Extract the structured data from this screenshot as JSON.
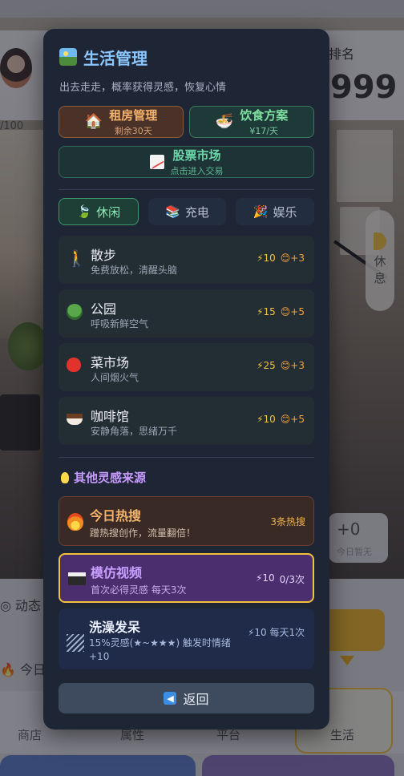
{
  "background": {
    "rank_label": "排名",
    "rank_value": "999",
    "progress_text": "/100",
    "rest_label": "休息",
    "plus_value": "+0",
    "plus_sub": "今日暂无",
    "dynamic_label": "动态",
    "today_label": "今日",
    "tabs": [
      "商店",
      "属性",
      "平台",
      "生活"
    ]
  },
  "modal": {
    "title": "生活管理",
    "subtitle": "出去走走，概率获得灵感，恢复心情",
    "rent": {
      "label": "租房管理",
      "detail": "剩余30天"
    },
    "food": {
      "label": "饮食方案",
      "detail": "¥17/天"
    },
    "stock": {
      "label": "股票市场",
      "detail": "点击进入交易"
    },
    "tabs": [
      {
        "label": "休闲",
        "icon": "leaf-icon"
      },
      {
        "label": "充电",
        "icon": "books-icon"
      },
      {
        "label": "娱乐",
        "icon": "party-icon"
      }
    ],
    "activities": [
      {
        "name": "散步",
        "desc": "免费放松，清醒头脑",
        "energy": "⚡10",
        "mood": "😊+3",
        "icon": "walk-icon"
      },
      {
        "name": "公园",
        "desc": "呼吸新鲜空气",
        "energy": "⚡15",
        "mood": "😊+5",
        "icon": "tree-icon"
      },
      {
        "name": "菜市场",
        "desc": "人间烟火气",
        "energy": "⚡25",
        "mood": "😊+3",
        "icon": "apple-icon"
      },
      {
        "name": "咖啡馆",
        "desc": "安静角落，思绪万千",
        "energy": "⚡10",
        "mood": "😊+5",
        "icon": "coffee-icon"
      }
    ],
    "other_title": "其他灵感来源",
    "sources": {
      "hot": {
        "name": "今日热搜",
        "desc": "蹭热搜创作，流量翻倍！",
        "right": "3条热搜"
      },
      "mimic": {
        "name": "模仿视频",
        "desc": "首次必得灵感  每天3次",
        "energy": "⚡10",
        "count": "0/3次"
      },
      "shower": {
        "name": "洗澡发呆",
        "desc": "15%灵感(★~★★★) 触发时情绪+10",
        "right": "⚡10  每天1次"
      }
    },
    "back_label": "返回"
  },
  "colors": {
    "modal_bg": "#1e2636",
    "accent_green": "#3c9a6a",
    "accent_gold": "#f2c23c",
    "accent_purple": "#c9a0ff"
  }
}
